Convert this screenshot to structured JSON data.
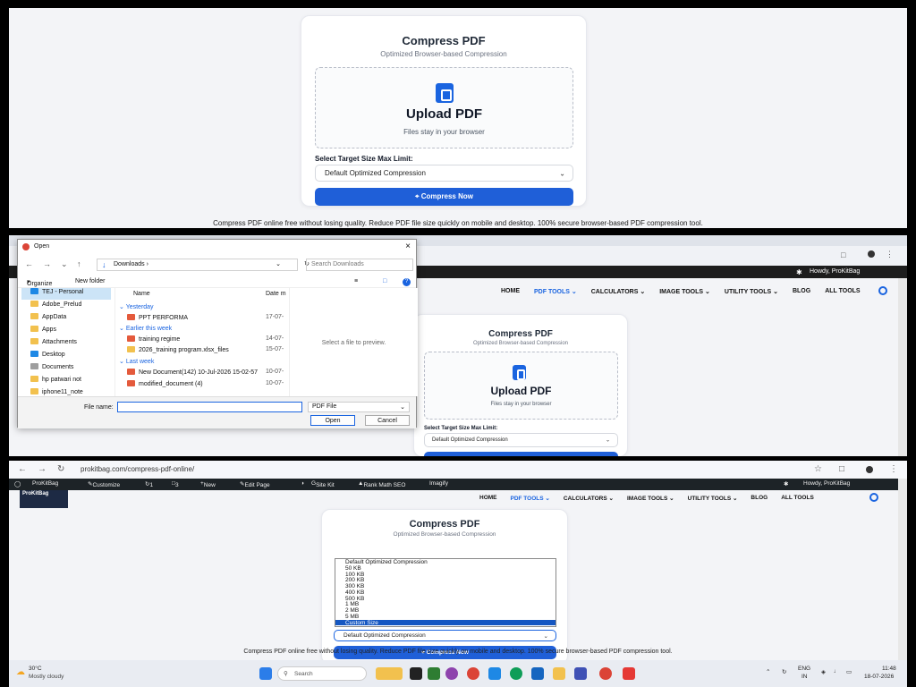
{
  "top": {
    "title": "Compress PDF",
    "subtitle": "Optimized Browser-based Compression",
    "upload_title": "Upload PDF",
    "upload_note": "Files stay in your browser",
    "select_label": "Select Target Size Max Limit:",
    "select_value": "Default Optimized Compression",
    "button": "Compress Now",
    "footer": "Compress PDF online free without losing quality. Reduce PDF file size quickly on mobile and desktop. 100% secure browser-based PDF compression tool."
  },
  "site": {
    "greeting": "Howdy, ProKitBag",
    "nav": [
      "HOME",
      "PDF TOOLS",
      "CALCULATORS",
      "IMAGE TOOLS",
      "UTILITY TOOLS",
      "BLOG",
      "ALL TOOLS"
    ]
  },
  "dialog": {
    "title": "Open",
    "path": "Downloads",
    "search_placeholder": "Search Downloads",
    "organize": "Organize",
    "new_folder": "New folder",
    "tree": [
      "TEJ - Personal",
      "Adobe_Prelud",
      "AppData",
      "Apps",
      "Attachments",
      "Desktop",
      "Documents",
      "hp patwari not",
      "iphone11_note"
    ],
    "col_name": "Name",
    "col_date": "Date m",
    "groups": [
      "Yesterday",
      "Earlier this week",
      "Last week"
    ],
    "files": [
      {
        "name": "PPT PERFORMA",
        "date": "17-07-"
      },
      {
        "name": "training regime",
        "date": "14-07-"
      },
      {
        "name": "2026_training program.xlsx_files",
        "date": "15-07-"
      },
      {
        "name": "New Document(142) 10-Jul-2026 15-02-57",
        "date": "10-07-"
      },
      {
        "name": "modified_document (4)",
        "date": "10-07-"
      }
    ],
    "preview_text": "Select a file to preview.",
    "filename_label": "File name:",
    "filetype": "PDF File",
    "open": "Open",
    "cancel": "Cancel"
  },
  "browser": {
    "url": "prokitbag.com/compress-pdf-online/"
  },
  "wpbar": {
    "items": [
      "ProKitBag",
      "Customize",
      "1",
      "3",
      "New",
      "Edit Page",
      "Site Kit",
      "Rank Math SEO",
      "Imagify"
    ],
    "greeting": "Howdy, ProKitBag"
  },
  "logo": "ProKitBag",
  "dropdown": {
    "options": [
      "Default Optimized Compression",
      "50 KB",
      "100 KB",
      "200 KB",
      "300 KB",
      "400 KB",
      "500 KB",
      "1 MB",
      "2 MB",
      "5 MB",
      "Custom Size"
    ],
    "highlighted": "Custom Size"
  },
  "taskbar": {
    "weather_temp": "30°C",
    "weather_desc": "Mostly cloudy",
    "search": "Search",
    "lang1": "ENG",
    "lang2": "IN",
    "time": "11:48",
    "date": "18-07-2026"
  }
}
